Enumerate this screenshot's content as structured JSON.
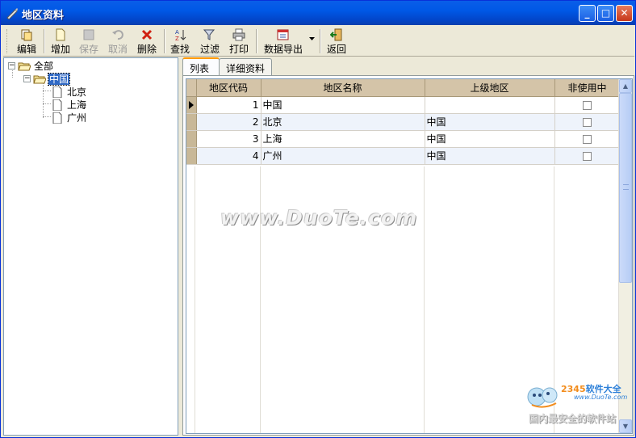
{
  "window": {
    "title": "地区资料",
    "minimize_glyph": "_",
    "maximize_glyph": "□",
    "close_glyph": "✕"
  },
  "toolbar": {
    "edit_label": "编辑",
    "add_label": "增加",
    "save_label": "保存",
    "cancel_label": "取消",
    "delete_label": "删除",
    "find_label": "查找",
    "filter_label": "过滤",
    "print_label": "打印",
    "export_label": "数据导出",
    "back_label": "返回"
  },
  "tree": {
    "root": "全部",
    "country": "中国",
    "cities": [
      "北京",
      "上海",
      "广州"
    ]
  },
  "tabs": {
    "list_label": "列表",
    "detail_label": "详细资料"
  },
  "grid": {
    "columns": [
      "地区代码",
      "地区名称",
      "上级地区",
      "非使用中"
    ],
    "rows": [
      {
        "code": "1",
        "name": "中国",
        "parent": "",
        "inactive": false
      },
      {
        "code": "2",
        "name": "北京",
        "parent": "中国",
        "inactive": false
      },
      {
        "code": "3",
        "name": "上海",
        "parent": "中国",
        "inactive": false
      },
      {
        "code": "4",
        "name": "广州",
        "parent": "中国",
        "inactive": false
      }
    ]
  },
  "watermark": {
    "text": "www.DuoTe.com"
  },
  "logo": {
    "brand_num": "2345",
    "brand_text": "软件大全",
    "url": "www.DuoTe.com",
    "slogan": "国内最安全的软件站"
  },
  "colors": {
    "titlebar": "#0058e6",
    "grid_header": "#d4c4a8",
    "selection": "#316ac5"
  }
}
